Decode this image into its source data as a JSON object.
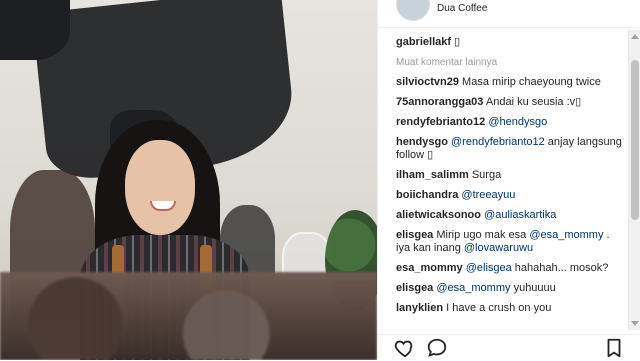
{
  "post": {
    "location": "Dua Coffee",
    "owner": "gabriellakf",
    "owner_caption": "▯",
    "load_more": "Muat komentar lainnya"
  },
  "comments": [
    {
      "user": "silvioctvn29",
      "text": "Masa mirip chaeyoung twice"
    },
    {
      "user": "75annorangga03",
      "text": "Andai ku seusia :v▯"
    },
    {
      "user": "rendyfebrianto12",
      "mention": "@hendysgo",
      "text": ""
    },
    {
      "user": "hendysgo",
      "mention": "@rendyfebrianto12",
      "text": " anjay langsung follow ▯"
    },
    {
      "user": "ilham_salimm",
      "text": "Surga"
    },
    {
      "user": "boiichandra",
      "mention": "@treeayuu",
      "text": ""
    },
    {
      "user": "alietwicaksonoo",
      "mention": "@auliaskartika",
      "text": ""
    },
    {
      "user": "elisgea",
      "pre": "Mirip ugo mak esa ",
      "mention": "@esa_mommy",
      "mid": " . iya kan inang ",
      "mention2": "@lovawaruwu"
    },
    {
      "user": "esa_mommy",
      "mention": "@elisgea",
      "text": " hahahah... mosok?"
    },
    {
      "user": "elisgea",
      "mention": "@esa_mommy",
      "text": " yuhuuuu"
    },
    {
      "user": "lanyklien",
      "text": "I have a crush on you"
    }
  ],
  "icons": {
    "like": "heart-icon",
    "comment": "comment-icon",
    "save": "bookmark-icon"
  }
}
